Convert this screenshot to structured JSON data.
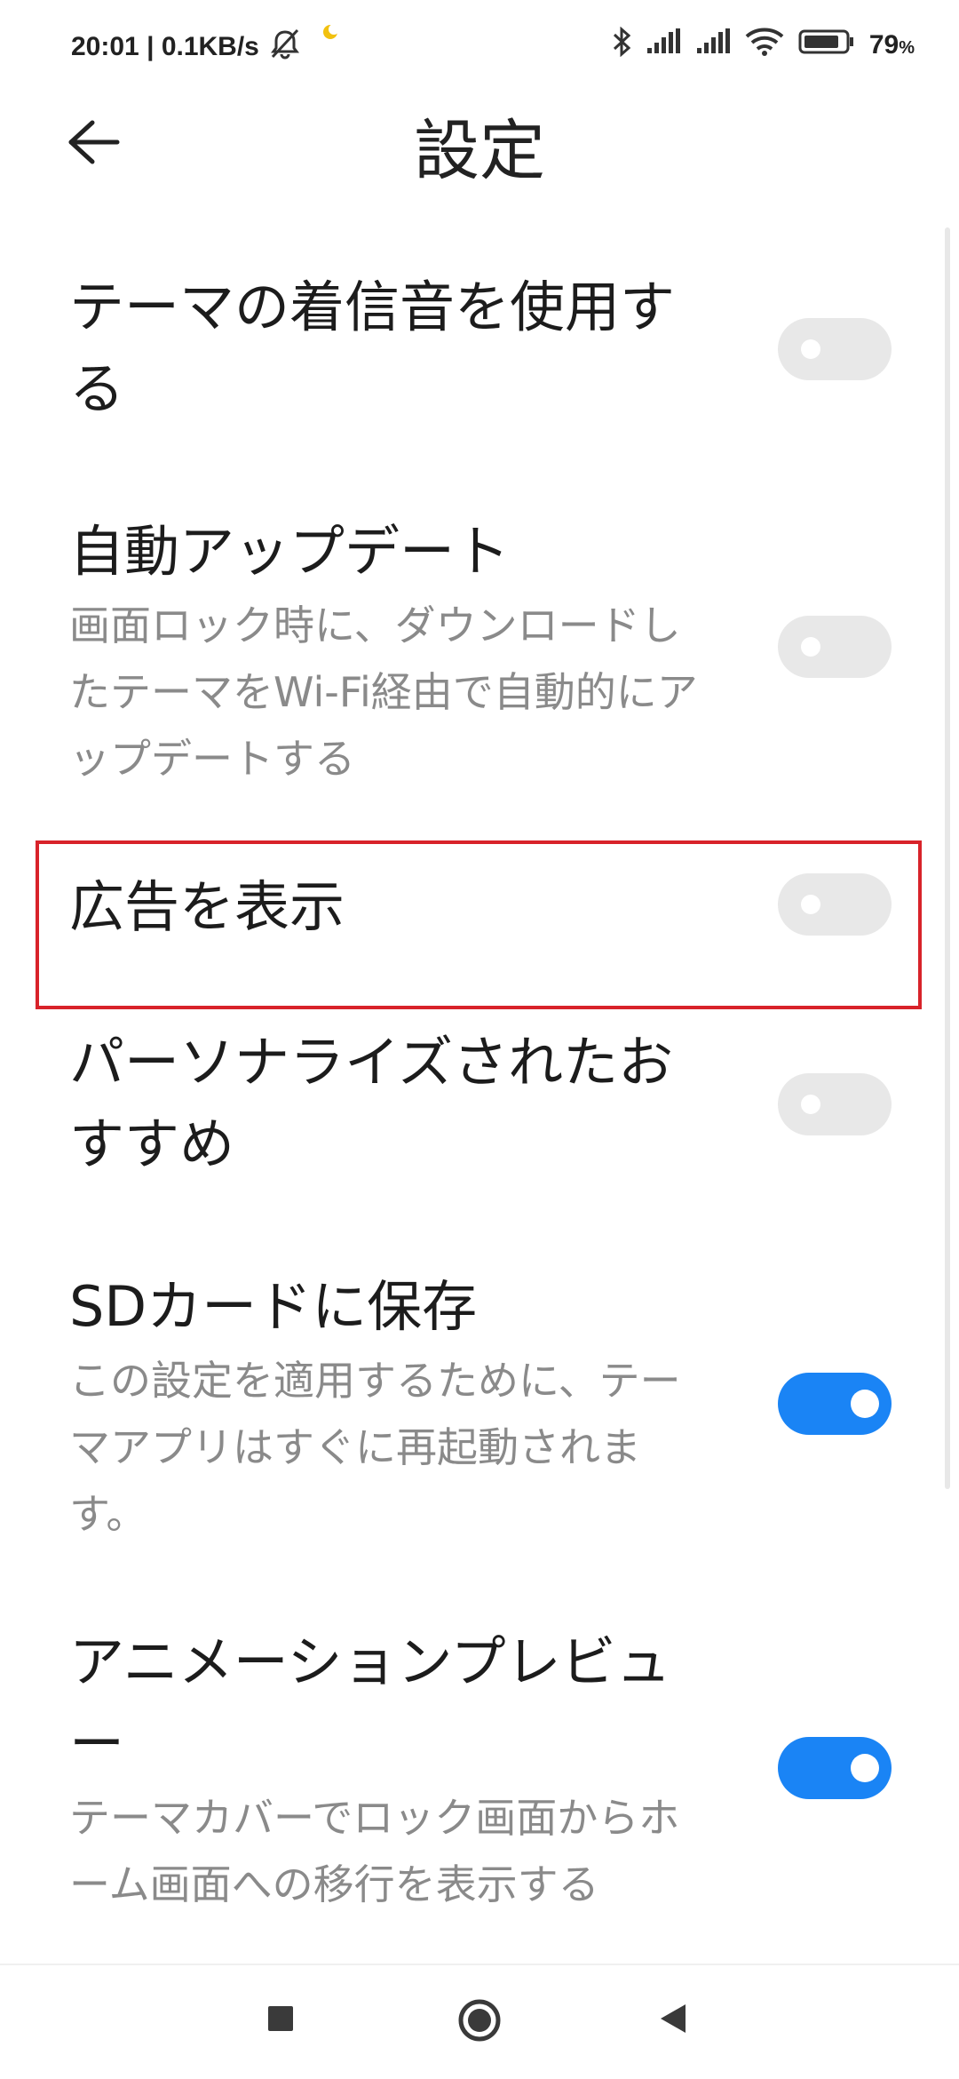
{
  "status_bar": {
    "time": "20:01",
    "speed": "0.1KB/s",
    "battery": "79",
    "battery_unit": "%",
    "icons": [
      "bell-off-icon",
      "moon-icon",
      "bluetooth-icon",
      "signal-icon",
      "signal-icon",
      "wifi-icon",
      "battery-icon"
    ]
  },
  "header": {
    "title": "設定",
    "back_icon": "arrow-left-icon"
  },
  "settings": [
    {
      "title_lines": [
        "テーマの着信音を使用す",
        "る"
      ],
      "desc_lines": [],
      "enabled": false
    },
    {
      "title_lines": [
        "自動アップデート"
      ],
      "desc_lines": [
        "画面ロック時に、ダウンロードし",
        "たテーマをWi-Fi経由で自動的にア",
        "ップデートする"
      ],
      "enabled": false
    },
    {
      "title_lines": [
        "広告を表示"
      ],
      "desc_lines": [],
      "enabled": false
    },
    {
      "title_lines": [
        "パーソナライズされたお",
        "すすめ"
      ],
      "desc_lines": [],
      "enabled": false
    },
    {
      "title_lines": [
        "SDカードに保存"
      ],
      "desc_lines": [
        "この設定を適用するために、テー",
        "マアプリはすぐに再起動されま",
        "す。"
      ],
      "enabled": true
    },
    {
      "title_lines": [
        "アニメーションプレビュ",
        "ー"
      ],
      "desc_lines": [
        "テーマカバーでロック画面からホ",
        "ーム画面への移行を表示する"
      ],
      "enabled": true
    }
  ],
  "colors": {
    "toggle_on": "#1a84f5",
    "toggle_off": "#e8e8e8",
    "highlight": "#d8232a"
  },
  "nav_bar": {
    "icons": [
      "recents-square-icon",
      "home-circle-icon",
      "back-triangle-icon"
    ]
  }
}
